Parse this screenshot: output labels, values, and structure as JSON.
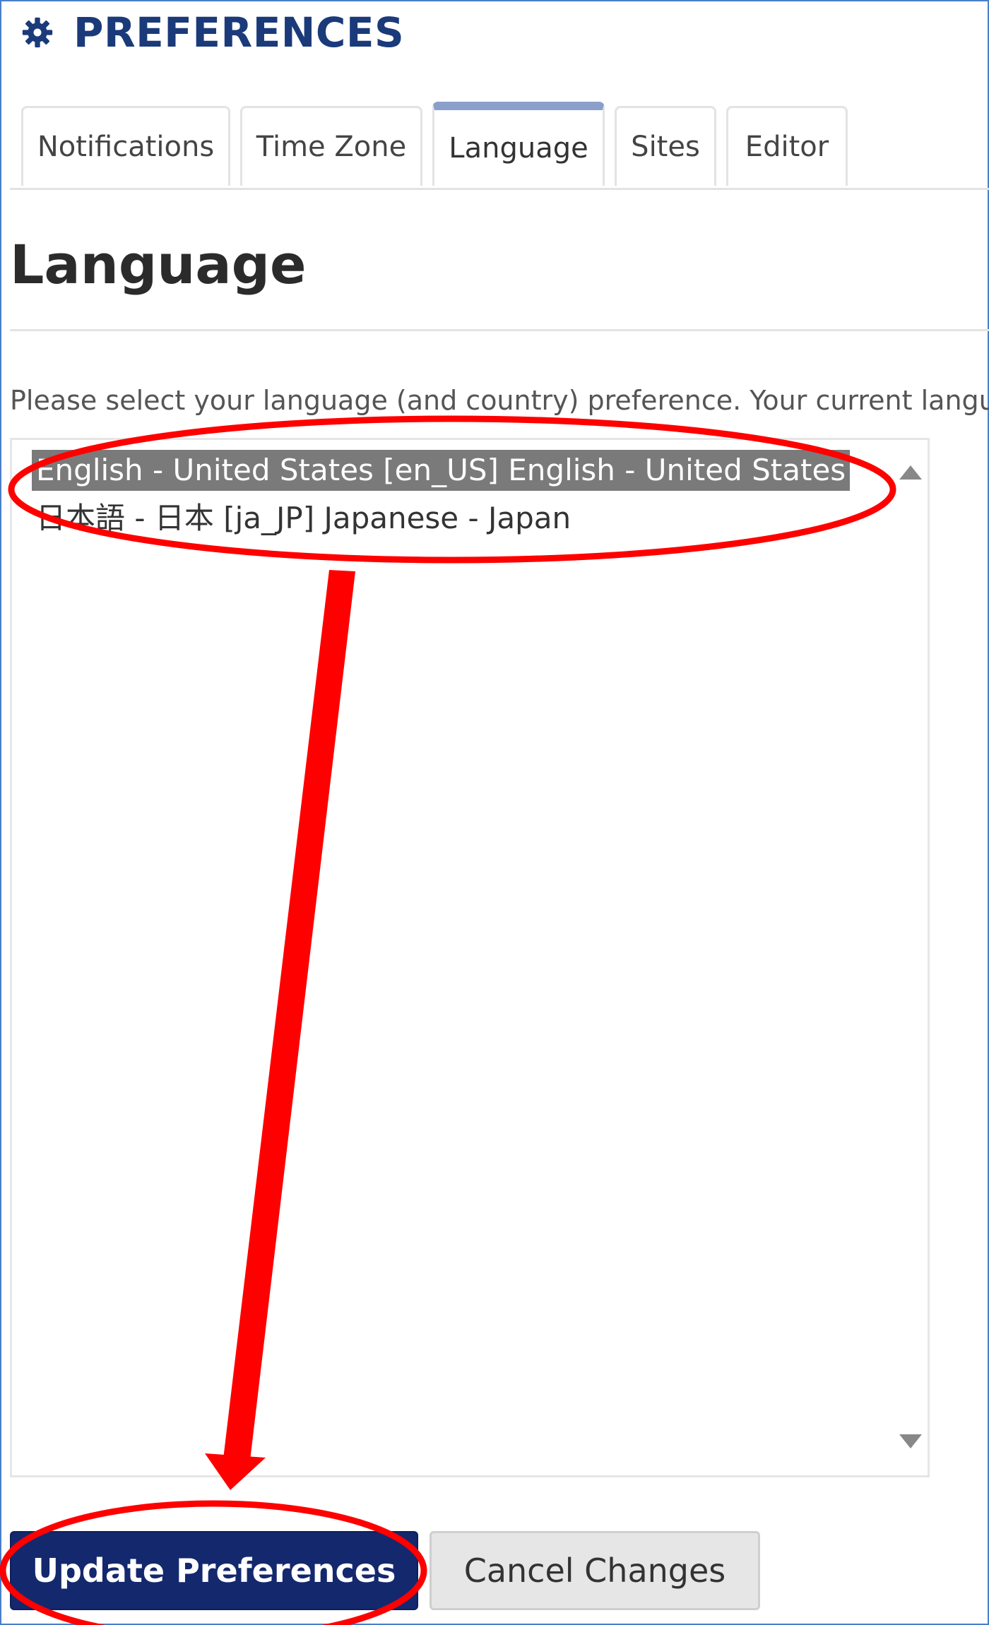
{
  "header": {
    "title": "PREFERENCES",
    "icon": "gear-icon"
  },
  "tabs": [
    {
      "label": "Notifications",
      "active": false
    },
    {
      "label": "Time Zone",
      "active": false
    },
    {
      "label": "Language",
      "active": true
    },
    {
      "label": "Sites",
      "active": false
    },
    {
      "label": "Editor",
      "active": false
    }
  ],
  "section": {
    "title": "Language",
    "instruction": "Please select your language (and country) preference. Your current langu"
  },
  "language_list": {
    "options": [
      {
        "label": "English - United States [en_US] English - United States",
        "selected": true
      },
      {
        "label": "日本語 - 日本 [ja_JP] Japanese - Japan",
        "selected": false
      }
    ]
  },
  "buttons": {
    "update": "Update Preferences",
    "cancel": "Cancel Changes"
  },
  "colors": {
    "accent": "#14286e",
    "header_text": "#1a3a7a",
    "annotation": "#ff0000",
    "active_tab_bar": "#8a9fc9",
    "selected_option": "#7a7a7a"
  }
}
